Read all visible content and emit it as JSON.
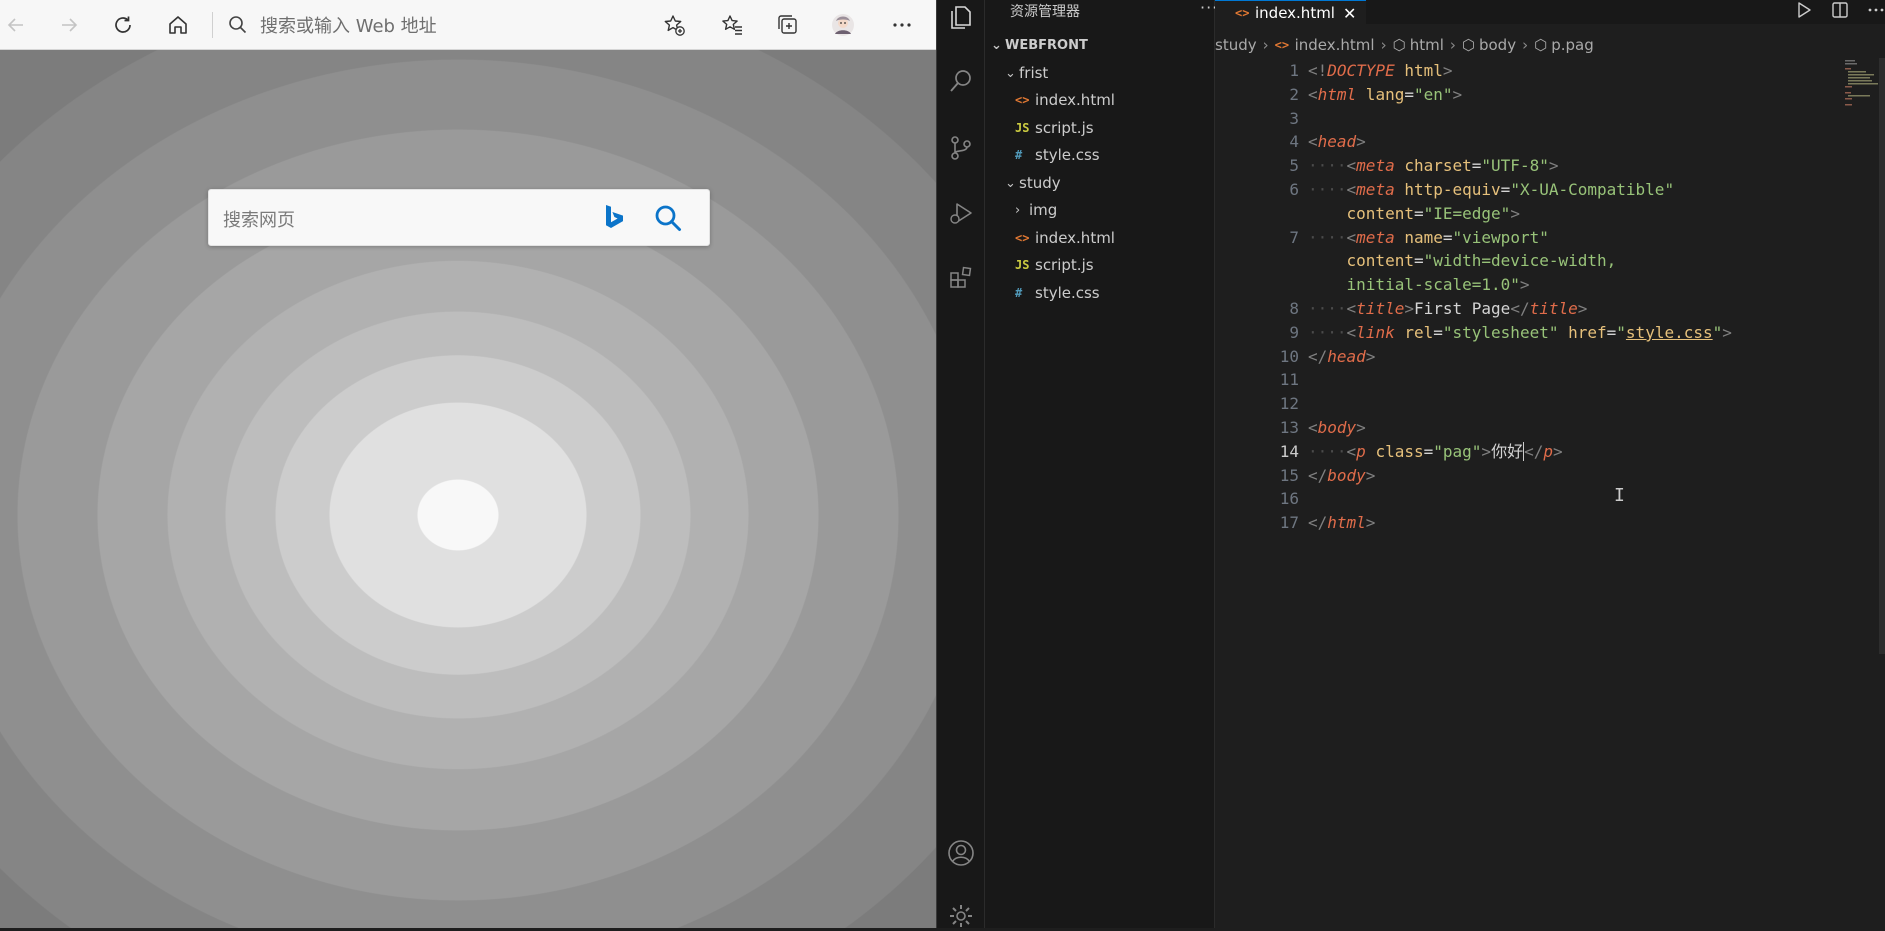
{
  "browser": {
    "toolbar": {
      "back_icon": "back-arrow-icon",
      "forward_icon": "forward-arrow-icon",
      "refresh_icon": "refresh-icon",
      "home_icon": "home-icon",
      "address_placeholder": "搜索或输入 Web 地址",
      "favorite_add_icon": "star-add-icon",
      "favorites_icon": "favorites-icon",
      "collections_icon": "collections-icon",
      "profile_icon": "avatar",
      "more_icon": "more-icon"
    },
    "page": {
      "search_placeholder": "搜索网页",
      "brand_color": "#0b74c9"
    }
  },
  "vscode": {
    "sidebar": {
      "title": "资源管理器",
      "more": "···",
      "root": "WEBFRONT",
      "tree": [
        {
          "label": "frist",
          "kind": "folder",
          "open": true
        },
        {
          "label": "index.html",
          "kind": "html"
        },
        {
          "label": "script.js",
          "kind": "js"
        },
        {
          "label": "style.css",
          "kind": "css"
        },
        {
          "label": "study",
          "kind": "folder",
          "open": true
        },
        {
          "label": "img",
          "kind": "folder",
          "open": false
        },
        {
          "label": "index.html",
          "kind": "html"
        },
        {
          "label": "script.js",
          "kind": "js"
        },
        {
          "label": "style.css",
          "kind": "css"
        }
      ],
      "icon_labels": {
        "html": "<>",
        "js": "JS",
        "css": "#"
      }
    },
    "tab": {
      "label": "index.html",
      "icon": "<>",
      "close": "✕"
    },
    "breadcrumb": [
      "study",
      "index.html",
      "html",
      "body",
      "p.pag"
    ],
    "code": {
      "line_numbers": [
        "1",
        "2",
        "3",
        "4",
        "5",
        "6",
        "",
        "7",
        "",
        "",
        "8",
        "9",
        "10",
        "11",
        "12",
        "13",
        "14",
        "15",
        "16",
        "17"
      ],
      "current_line": "14"
    },
    "accent_color": "#0078d4"
  }
}
